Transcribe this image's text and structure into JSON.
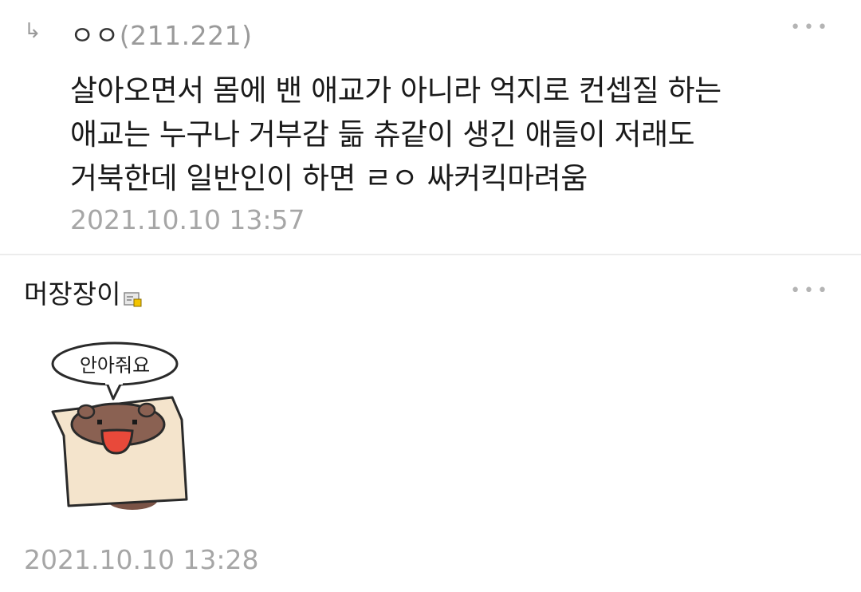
{
  "reply": {
    "arrow": "↳",
    "author_name": "ㅇㅇ",
    "author_ip": "(211.221)",
    "more": "•••",
    "body_lines": [
      "살아오면서 몸에 밴 애교가 아니라 억지로 컨셉질 하는",
      "애교는 누구나 거부감 듦 츄같이 생긴 애들이 저래도",
      "거북한데 일반인이 하면 ㄹㅇ 싸커킥마려움"
    ],
    "date": "2021.10.10 13:57"
  },
  "comment": {
    "author_name": "머장장이",
    "grade_icon": "gallery-member-icon",
    "more": "•••",
    "sticker_text": "안아줘요",
    "date": "2021.10.10 13:28"
  }
}
